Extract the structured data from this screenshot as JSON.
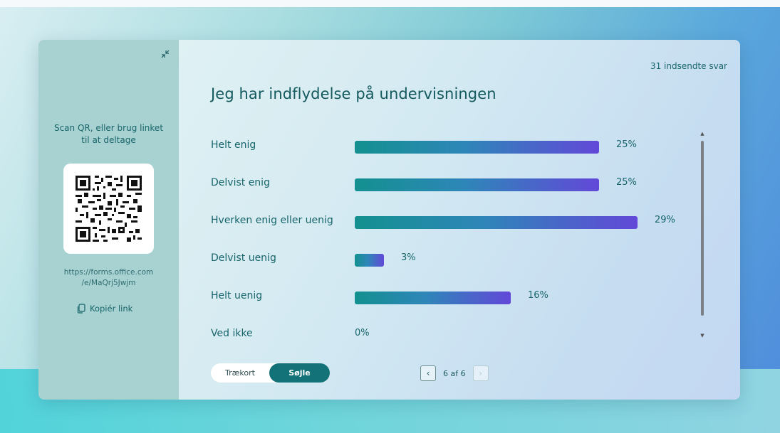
{
  "sidebar": {
    "scan_text": "Scan QR, eller brug linket til at deltage",
    "url_line1": "https://forms.office.com",
    "url_line2": "/e/MaQrj5Jwjm",
    "copy_label": "Kopiér link"
  },
  "header": {
    "responses": "31 indsendte svar",
    "question": "Jeg har indflydelse på undervisningen"
  },
  "chart_data": {
    "type": "bar",
    "orientation": "horizontal",
    "categories": [
      "Helt enig",
      "Delvist enig",
      "Hverken enig eller uenig",
      "Delvist uenig",
      "Helt uenig",
      "Ved ikke"
    ],
    "values": [
      25,
      25,
      29,
      3,
      16,
      0
    ],
    "value_labels": [
      "25%",
      "25%",
      "29%",
      "3%",
      "16%",
      "0%"
    ],
    "xlim": [
      0,
      100
    ],
    "unit": "%"
  },
  "footer": {
    "toggle_options": [
      "Trækort",
      "Søjle"
    ],
    "active_option": "Søjle",
    "page_indicator": "6 af 6"
  },
  "icons": {
    "collapse": "collapse-icon",
    "copy": "copy-icon",
    "prev": "chevron-left-icon",
    "next": "chevron-right-icon"
  }
}
